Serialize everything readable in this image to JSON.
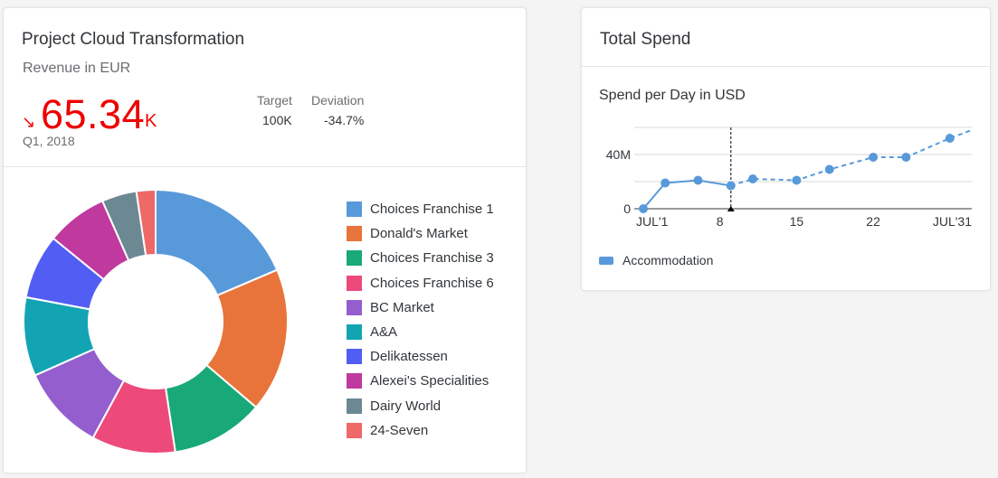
{
  "left_card": {
    "title": "Project Cloud Transformation",
    "subtitle": "Revenue in EUR",
    "kpi": {
      "trend_icon": "↘",
      "value": "65.34",
      "unit": "K",
      "period": "Q1, 2018",
      "color": "#e00000"
    },
    "target_label": "Target",
    "target_value": "100K",
    "deviation_label": "Deviation",
    "deviation_value": "-34.7%",
    "chart_data": {
      "type": "pie",
      "style": "donut",
      "labels": [
        "Choices Franchise 1",
        "Donald's Market",
        "Choices Franchise 3",
        "Choices Franchise 6",
        "BC Market",
        "A&A",
        "Delikatessen",
        "Alexei's Specialities",
        "Dairy World",
        "24-Seven"
      ],
      "values": [
        18.3,
        17.4,
        11.2,
        10.1,
        10.3,
        9.5,
        7.8,
        7.4,
        4.2,
        2.3
      ],
      "colors": [
        "#5899da",
        "#e8743b",
        "#19a979",
        "#ed4a7b",
        "#945ecf",
        "#13a4b4",
        "#525df4",
        "#bf399e",
        "#6c8893",
        "#ee6868"
      ],
      "legend": "right"
    }
  },
  "right_card": {
    "title": "Total Spend",
    "subtitle": "Spend per Day in USD",
    "chart_data": {
      "type": "line",
      "title": "Spend per Day in USD",
      "x": [
        1,
        3,
        6,
        9,
        11,
        15,
        18,
        22,
        25,
        29,
        31
      ],
      "y": [
        0,
        19,
        21,
        17,
        22,
        21,
        29,
        38,
        38,
        52,
        58
      ],
      "y_unit": "M",
      "actual_until_x": 9,
      "forecast_from_x": 9,
      "marker_x": 9,
      "x_ticks": [
        1,
        8,
        15,
        22,
        31
      ],
      "x_tick_labels": [
        "JUL'1",
        "8",
        "15",
        "22",
        "JUL'31"
      ],
      "y_ticks": [
        0,
        40
      ],
      "y_tick_labels": [
        "0",
        "40M"
      ],
      "xlim": [
        1,
        31
      ],
      "ylim": [
        0,
        60
      ],
      "series": [
        {
          "name": "Accommodation",
          "color": "#5899da"
        }
      ],
      "grid": true,
      "legend": "bottom-left"
    }
  }
}
